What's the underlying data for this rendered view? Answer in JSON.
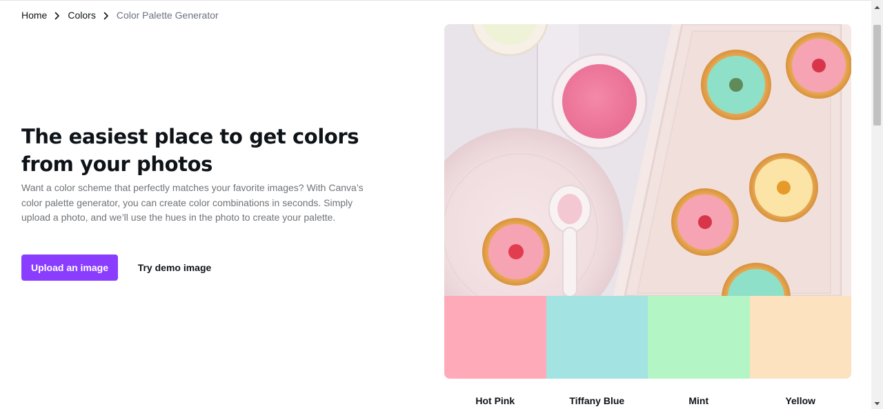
{
  "breadcrumb": {
    "home": "Home",
    "colors": "Colors",
    "current": "Color Palette Generator"
  },
  "hero": {
    "title": "The easiest place to get colors from your photos",
    "description": "Want a color scheme that perfectly matches your favorite images? With Canva’s color palette generator, you can create color combinations in seconds. Simply upload a photo, and we’ll use the hues in the photo to create your palette.",
    "upload_button": "Upload an image",
    "demo_button": "Try demo image"
  },
  "colors": {
    "accent": "#8b3dff"
  },
  "palette": [
    {
      "name": "Hot Pink",
      "hex": "#ffaab8"
    },
    {
      "name": "Tiffany Blue",
      "hex": "#a3e4e2"
    },
    {
      "name": "Mint",
      "hex": "#b3f5c5"
    },
    {
      "name": "Yellow",
      "hex": "#fce2bf"
    }
  ],
  "icons": {
    "breadcrumb_separator": "chevron-right-icon",
    "scroll_up": "triangle-up-icon",
    "scroll_down": "triangle-down-icon"
  }
}
